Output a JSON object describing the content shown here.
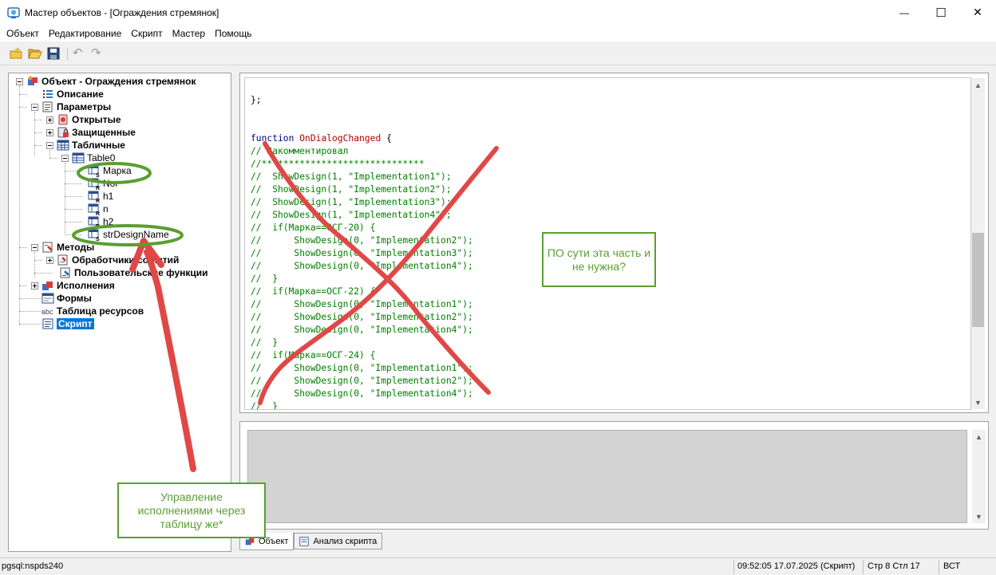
{
  "window": {
    "title": "Мастер объектов - [Ограждения стремянок]",
    "minimize_glyph": "—",
    "maximize_glyph": "☐",
    "close_glyph": "✕"
  },
  "menu": [
    "Объект",
    "Редактирование",
    "Скрипт",
    "Мастер",
    "Помощь"
  ],
  "toolbar": {
    "buttons": [
      "new-object-icon",
      "open-folder-icon",
      "save-disk-icon",
      "undo-icon",
      "redo-icon"
    ],
    "undo_glyph": "↶",
    "redo_glyph": "↷"
  },
  "tree": {
    "root": "Объект - Ограждения стремянок",
    "description": "Описание",
    "parameters": "Параметры",
    "open": "Открытые",
    "protected": "Защищенные",
    "tabular": "Табличные",
    "table0": "Table0",
    "col_marka": "Марка",
    "col_nor": "Nor",
    "col_h1": "h1",
    "col_n": "n",
    "col_h2": "h2",
    "col_design": "strDesignName",
    "methods": "Методы",
    "event_handlers": "Обработчики событий",
    "user_functions": "Пользовательские функции",
    "executions": "Исполнения",
    "forms": "Формы",
    "resources": "Таблица ресурсов",
    "script": "Скрипт"
  },
  "code": {
    "lines": [
      "};",
      "",
      "",
      "function OnDialogChanged {",
      "// Закомментировал",
      "//******************************",
      "//  ShowDesign(1, \"Implementation1\");",
      "//  ShowDesign(1, \"Implementation2\");",
      "//  ShowDesign(1, \"Implementation3\");",
      "//  ShowDesign(1, \"Implementation4\");",
      "//  if(Марка==ОСГ-20) {",
      "//      ShowDesign(0, \"Implementation2\");",
      "//      ShowDesign(0, \"Implementation3\");",
      "//      ShowDesign(0, \"Implementation4\");",
      "//  }",
      "//  if(Марка==ОСГ-22) {",
      "//      ShowDesign(0, \"Implementation1\");",
      "//      ShowDesign(0, \"Implementation2\");",
      "//      ShowDesign(0, \"Implementation4\");",
      "//  }",
      "//  if(Марка==ОСГ-24) {",
      "//      ShowDesign(0, \"Implementation1\");",
      "//      ShowDesign(0, \"Implementation2\");",
      "//      ShowDesign(0, \"Implementation4\");",
      "//  }"
    ],
    "keyword": "function",
    "function_name": "OnDialogChanged"
  },
  "tabs": [
    "Объект",
    "Анализ скрипта"
  ],
  "status": {
    "connection": "pgsql:nspds240",
    "datetime": "09:52:05  17.07.2025  (Скрипт)",
    "position": "Стр 8 Стл 17",
    "mode": "ВСТ"
  },
  "annotations": {
    "callout_right": "ПО сути эта часть и не нужна?",
    "callout_bottom": "Управление исполнениями через таблицу же*",
    "annotation_red": "#e04848",
    "annotation_green": "#5a9e32"
  }
}
